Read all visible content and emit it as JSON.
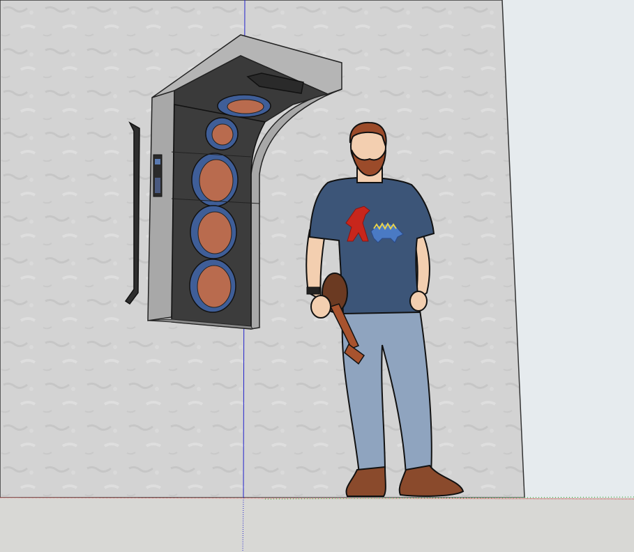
{
  "app": {
    "viewport": "3d-modeling-viewport"
  },
  "scene": {
    "wall_color": "#d3d3d3",
    "sky_color": "#e6ebee",
    "ground_color": "#d8d8d5",
    "axis_colors": {
      "blue": "#2222cc",
      "red": "#cc3333",
      "green": "#22aa22"
    },
    "speaker_cabinet": {
      "panel_color": "#3c3c3c",
      "frame_color": "#a8a8a8",
      "driver_cone_color": "#b96b4e",
      "driver_ring_color": "#3f5e98",
      "driver_count": 5
    },
    "figure": {
      "shirt_color": "#3c5578",
      "jeans_color": "#8fa4bf",
      "hair_color": "#9b4b2a",
      "shoe_color": "#8a4a2c",
      "instrument": "ukulele",
      "shirt_graphic": [
        "red-dinosaur",
        "blue-dinosaur"
      ]
    }
  }
}
